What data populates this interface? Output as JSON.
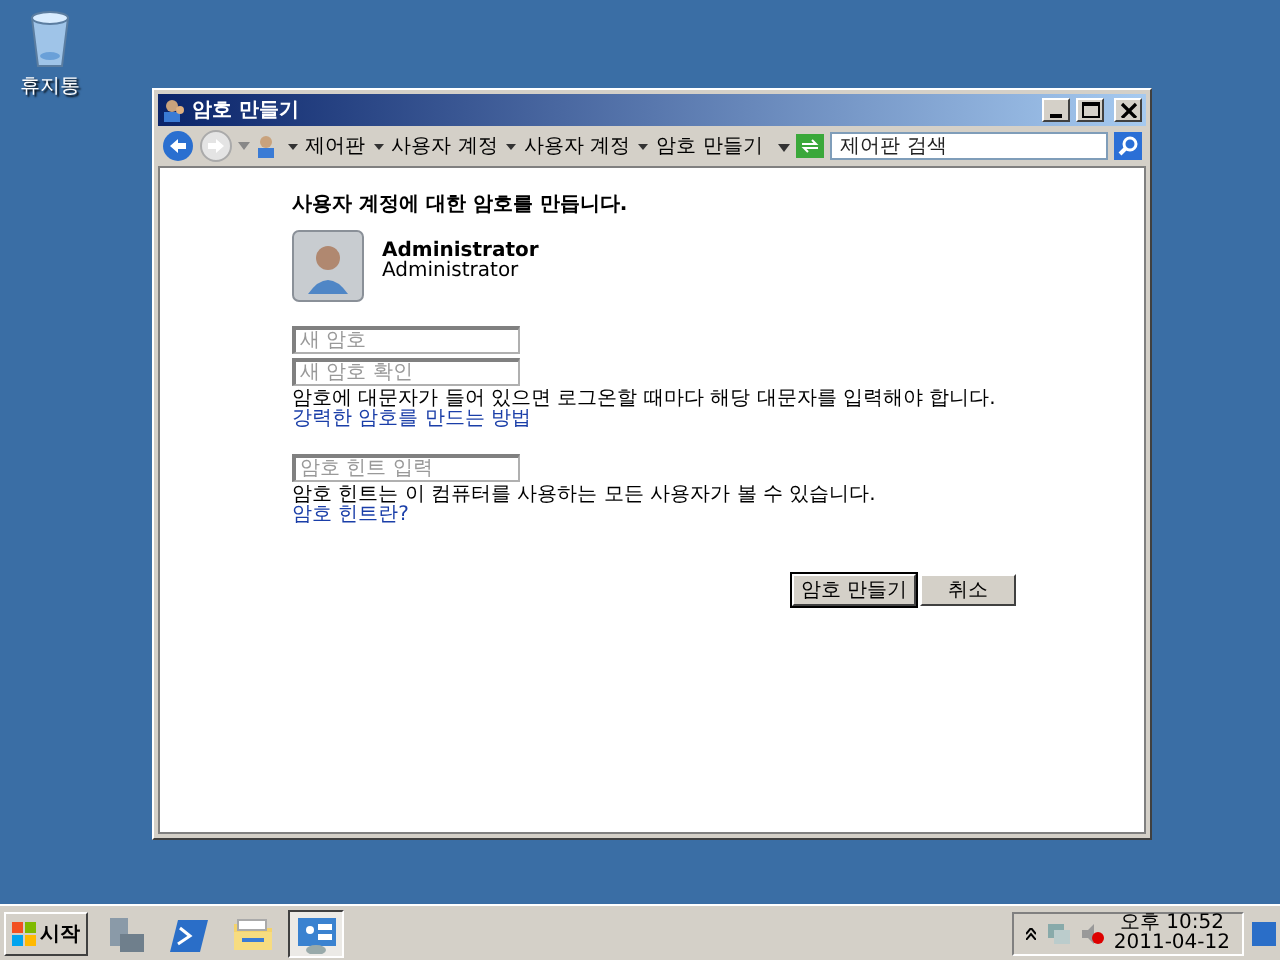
{
  "desktop_icons": [
    {
      "label": "휴지통"
    }
  ],
  "window": {
    "title": "암호 만들기",
    "breadcrumbs": [
      "제어판",
      "사용자 계정",
      "사용자 계정",
      "암호 만들기"
    ],
    "search": {
      "placeholder": "제어판 검색"
    },
    "heading": "사용자 계정에 대한 암호를 만듭니다.",
    "user": {
      "name": "Administrator",
      "role": "Administrator"
    },
    "fields": [
      {
        "placeholder": "새 암호"
      },
      {
        "placeholder": "새 암호 확인"
      }
    ],
    "caps_note": "암호에 대문자가 들어 있으면 로그온할 때마다 해당 대문자를 입력해야 합니다.",
    "strong_link": "강력한 암호를 만드는 방법",
    "hint_field": {
      "placeholder": "암호 힌트 입력"
    },
    "hint_note": "암호 힌트는 이 컴퓨터를 사용하는 모든 사용자가 볼 수 있습니다.",
    "hint_link": "암호 힌트란?",
    "buttons": [
      {
        "label": "암호 만들기",
        "default": true
      },
      {
        "label": "취소",
        "default": false
      }
    ]
  },
  "taskbar": {
    "start": "시작",
    "apps": [
      {
        "kind": "server",
        "selected": false
      },
      {
        "kind": "powershell",
        "selected": false
      },
      {
        "kind": "folder",
        "selected": false
      },
      {
        "kind": "control-panel",
        "selected": true
      }
    ],
    "clock": {
      "time": "오후 10:52",
      "date": "2011-04-12"
    }
  }
}
